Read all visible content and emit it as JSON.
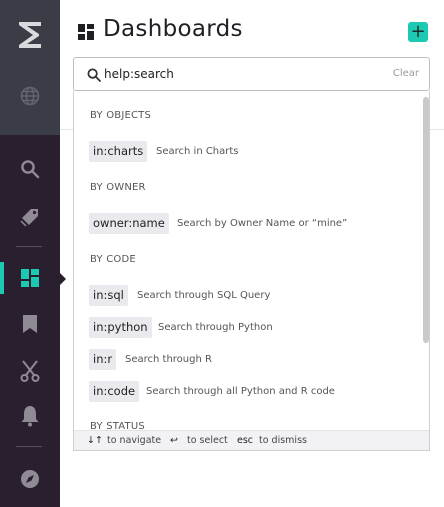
{
  "header": {
    "title": "Dashboards",
    "add_label": "+"
  },
  "search": {
    "value": "help:search",
    "clear_label": "Clear"
  },
  "dropdown": {
    "sections": [
      {
        "heading": "BY OBJECTS",
        "items": [
          {
            "token": "in:charts",
            "hint": "Search in Charts"
          }
        ]
      },
      {
        "heading": "BY OWNER",
        "items": [
          {
            "token": "owner:name",
            "hint": "Search by Owner Name or “mine”"
          }
        ]
      },
      {
        "heading": "BY CODE",
        "items": [
          {
            "token": "in:sql",
            "hint": "Search through SQL Query"
          },
          {
            "token": "in:python",
            "hint": "Search through Python"
          },
          {
            "token": "in:r",
            "hint": "Search through R"
          },
          {
            "token": "in:code",
            "hint": "Search through all Python and R code"
          }
        ]
      },
      {
        "heading": "BY STATUS",
        "items": []
      }
    ],
    "footer": {
      "navigate_keys": "↓↑",
      "navigate_label": "to navigate",
      "select_key": "↩",
      "select_label": "to select",
      "dismiss_key": "esc",
      "dismiss_label": "to dismiss"
    }
  },
  "nav": {
    "items": [
      {
        "icon": "logo-icon"
      },
      {
        "icon": "globe-icon"
      },
      {
        "icon": "search-icon"
      },
      {
        "icon": "tag-icon"
      },
      {
        "icon": "dashboard-icon",
        "active": true
      },
      {
        "icon": "bookmark-icon"
      },
      {
        "icon": "scissors-icon"
      },
      {
        "icon": "bell-icon"
      },
      {
        "icon": "compass-icon"
      }
    ]
  },
  "colors": {
    "accent": "#1ec9b4",
    "nav_bg": "#2a1f2e",
    "nav_top_bg": "#3a3c46"
  }
}
